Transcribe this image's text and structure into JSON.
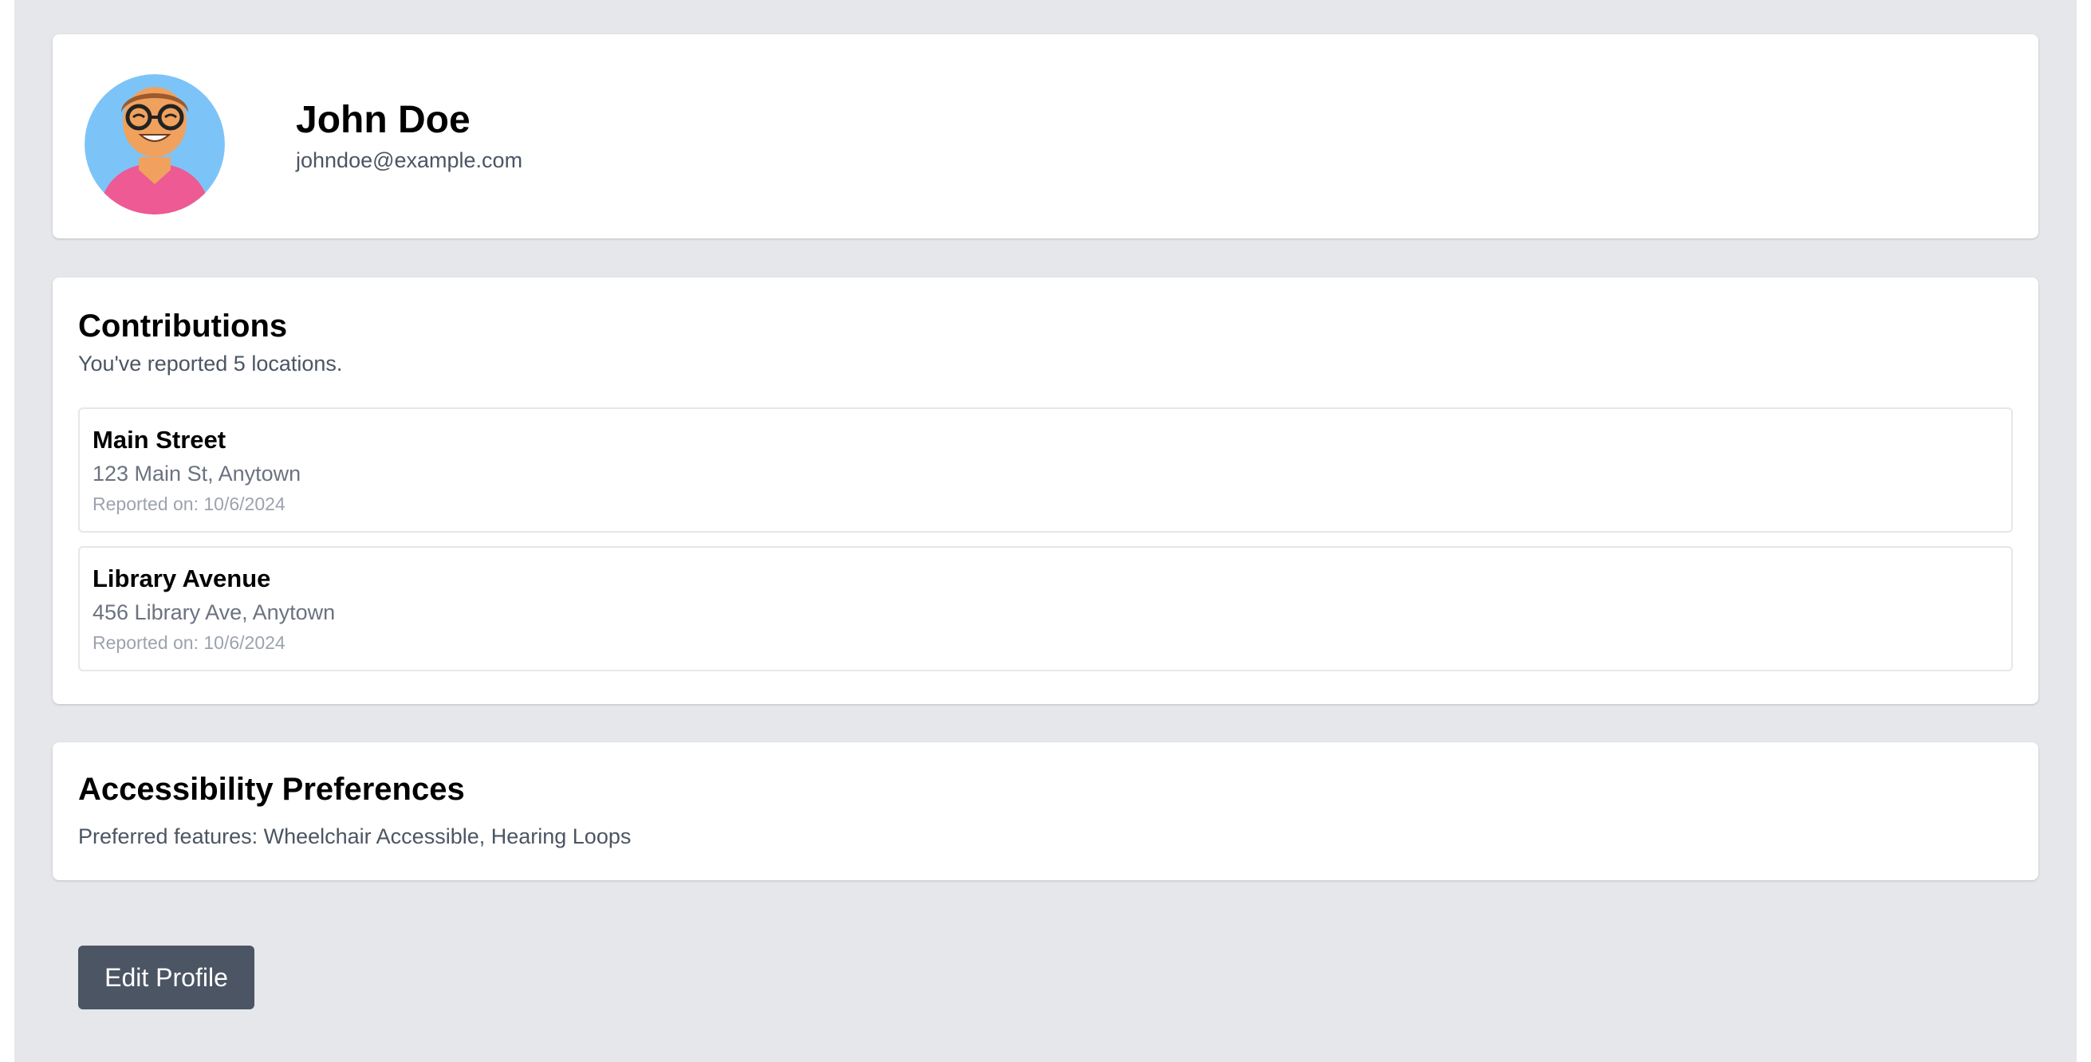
{
  "profile": {
    "name": "John Doe",
    "email": "johndoe@example.com",
    "avatar_icon": "user-avatar-illustration"
  },
  "contributions": {
    "title": "Contributions",
    "summary": "You've reported 5 locations.",
    "items": [
      {
        "name": "Main Street",
        "address": "123 Main St, Anytown",
        "reported": "Reported on: 10/6/2024"
      },
      {
        "name": "Library Avenue",
        "address": "456 Library Ave, Anytown",
        "reported": "Reported on: 10/6/2024"
      }
    ]
  },
  "preferences": {
    "title": "Accessibility Preferences",
    "text": "Preferred features: Wheelchair Accessible, Hearing Loops"
  },
  "actions": {
    "edit_label": "Edit Profile"
  },
  "colors": {
    "page_background": "#e5e7eb",
    "card_background": "#ffffff",
    "button_background": "#4b5563",
    "muted_text": "#4b5563"
  }
}
